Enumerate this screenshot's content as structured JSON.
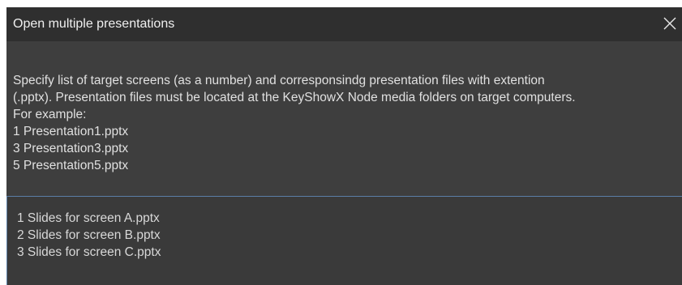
{
  "window": {
    "title": "Open multiple presentations"
  },
  "description": {
    "line1": "Specify list of target screens (as a number) and corresponsindg presentation files with extention",
    "line2": "(.pptx). Presentation files must be located at the KeyShowX Node media folders on target computers.",
    "line3": "For example:",
    "examples": [
      "1 Presentation1.pptx",
      "3 Presentation3.pptx",
      "5 Presentation5.pptx"
    ]
  },
  "editor": {
    "lines": [
      "1 Slides for screen A.pptx",
      "2 Slides for screen B.pptx",
      "3 Slides for screen C.pptx"
    ]
  },
  "colors": {
    "dialog_bg": "#3e3e3e",
    "titlebar_bg": "#2f2f2f",
    "editor_border": "#5a7ea6"
  }
}
